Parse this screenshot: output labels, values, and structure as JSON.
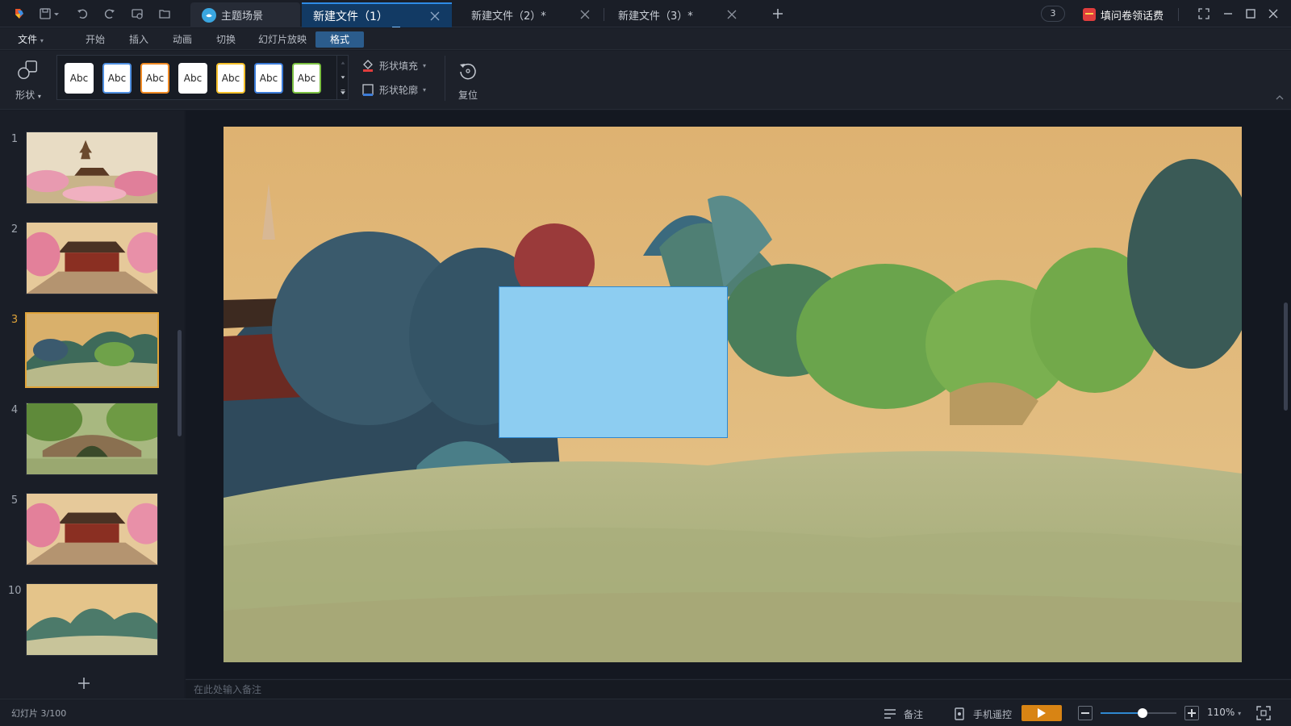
{
  "titlebar": {
    "tabs": [
      {
        "label": "主题场景"
      },
      {
        "label": "新建文件（1）"
      },
      {
        "label": "新建文件（2）*"
      },
      {
        "label": "新建文件（3）*"
      }
    ],
    "notification_count": "3",
    "promo_label": "填问卷领话费"
  },
  "menu": {
    "file": "文件",
    "items": [
      "开始",
      "插入",
      "动画",
      "切换",
      "幻灯片放映",
      "格式"
    ],
    "active": "格式"
  },
  "ribbon": {
    "shape_label": "形状",
    "styles": [
      {
        "label": "Abc",
        "border": "#ffffff"
      },
      {
        "label": "Abc",
        "border": "#4f8fe0"
      },
      {
        "label": "Abc",
        "border": "#f08a24"
      },
      {
        "label": "Abc",
        "border": "#ffffff"
      },
      {
        "label": "Abc",
        "border": "#f5c02a"
      },
      {
        "label": "Abc",
        "border": "#3b7bd8"
      },
      {
        "label": "Abc",
        "border": "#7cc142"
      }
    ],
    "fill_label": "形状填充",
    "outline_label": "形状轮廓",
    "reset_label": "复位"
  },
  "slides": {
    "items": [
      {
        "number": "1",
        "theme": "pagoda-blossom"
      },
      {
        "number": "2",
        "theme": "temple-courtyard"
      },
      {
        "number": "3",
        "theme": "riverside-willows",
        "active": true
      },
      {
        "number": "4",
        "theme": "stone-bridge"
      },
      {
        "number": "5",
        "theme": "temple-courtyard"
      },
      {
        "number": "10",
        "theme": "mountain-landscape"
      }
    ]
  },
  "notes": {
    "placeholder": "在此处输入备注"
  },
  "status": {
    "slide_indicator": "幻灯片 3/100",
    "notes_label": "备注",
    "remote_label": "手机遥控",
    "zoom": "110%",
    "zoom_fraction": 0.55
  },
  "colors": {
    "accent": "#2f88d0",
    "shape_fill": "#8dcdf1",
    "play_button": "#d88414",
    "active_thumb_border": "#e0a43a"
  }
}
